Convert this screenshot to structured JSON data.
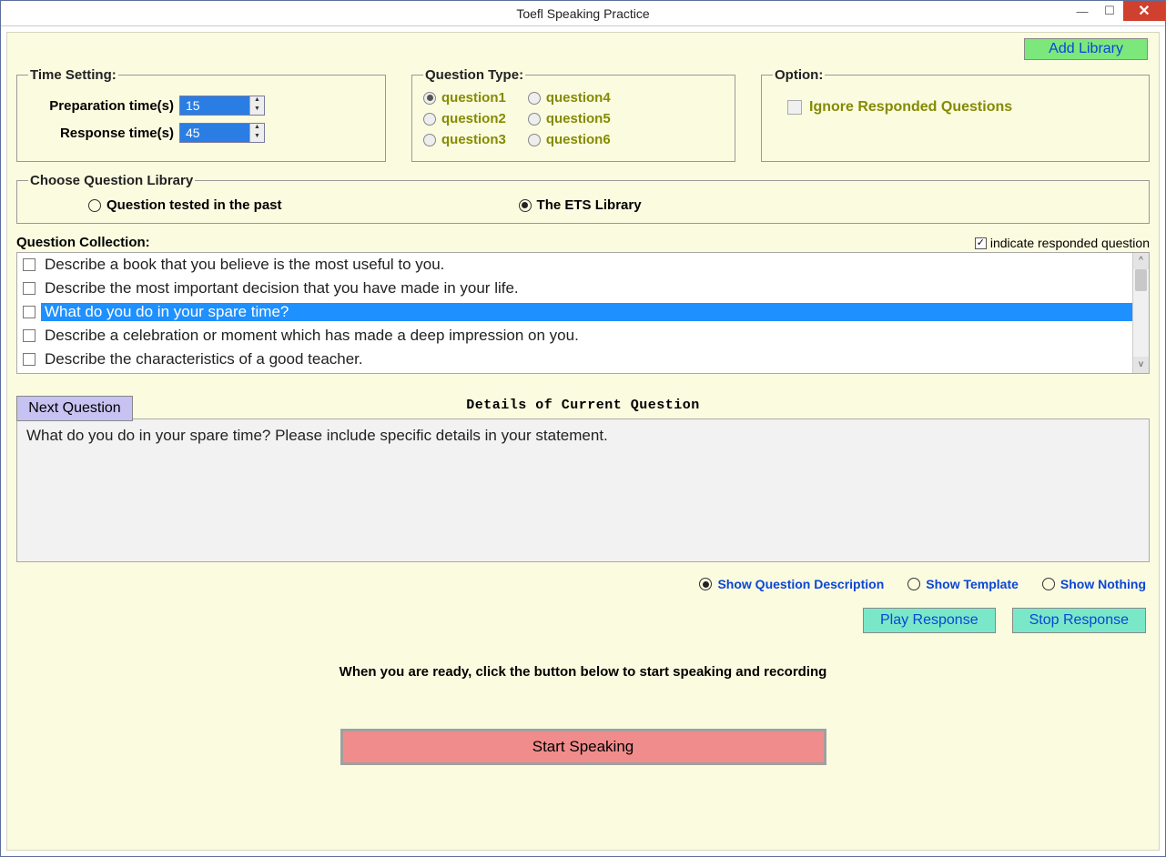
{
  "window": {
    "title": "Toefl Speaking Practice"
  },
  "add_library_label": "Add Library",
  "time_setting": {
    "legend": "Time Setting:",
    "prep_label": "Preparation time(s)",
    "prep_value": "15",
    "resp_label": "Response time(s)",
    "resp_value": "45"
  },
  "question_type": {
    "legend": "Question Type:",
    "col1": [
      "question1",
      "question2",
      "question3"
    ],
    "col2": [
      "question4",
      "question5",
      "question6"
    ],
    "selected": "question1"
  },
  "option": {
    "legend": "Option:",
    "ignore_label": "Ignore Responded Questions",
    "ignore_checked": false
  },
  "library": {
    "legend": "Choose Question Library",
    "opt1": "Question tested in the past",
    "opt2": "The ETS Library",
    "selected": 1
  },
  "collection": {
    "title": "Question Collection:",
    "indicate_label": "indicate responded question",
    "indicate_checked": true,
    "items": [
      "Describe a book that you believe is the most useful to you.",
      "Describe the most important decision that you have made in your life.",
      "What do you do in your spare time?",
      "Describe a celebration or moment which has made a deep impression on you.",
      "Describe the characteristics of a good teacher."
    ],
    "selected_index": 2
  },
  "next_question_label": "Next Question",
  "details_title": "Details of Current Question",
  "details_text": "What do you do in your spare time? Please include specific details in your statement.",
  "show_options": {
    "opt1": "Show Question Description",
    "opt2": "Show Template",
    "opt3": "Show Nothing",
    "selected": 0
  },
  "play_response_label": "Play Response",
  "stop_response_label": "Stop Response",
  "ready_message": "When you are ready, click the button below to start speaking and recording",
  "start_speaking_label": "Start Speaking"
}
